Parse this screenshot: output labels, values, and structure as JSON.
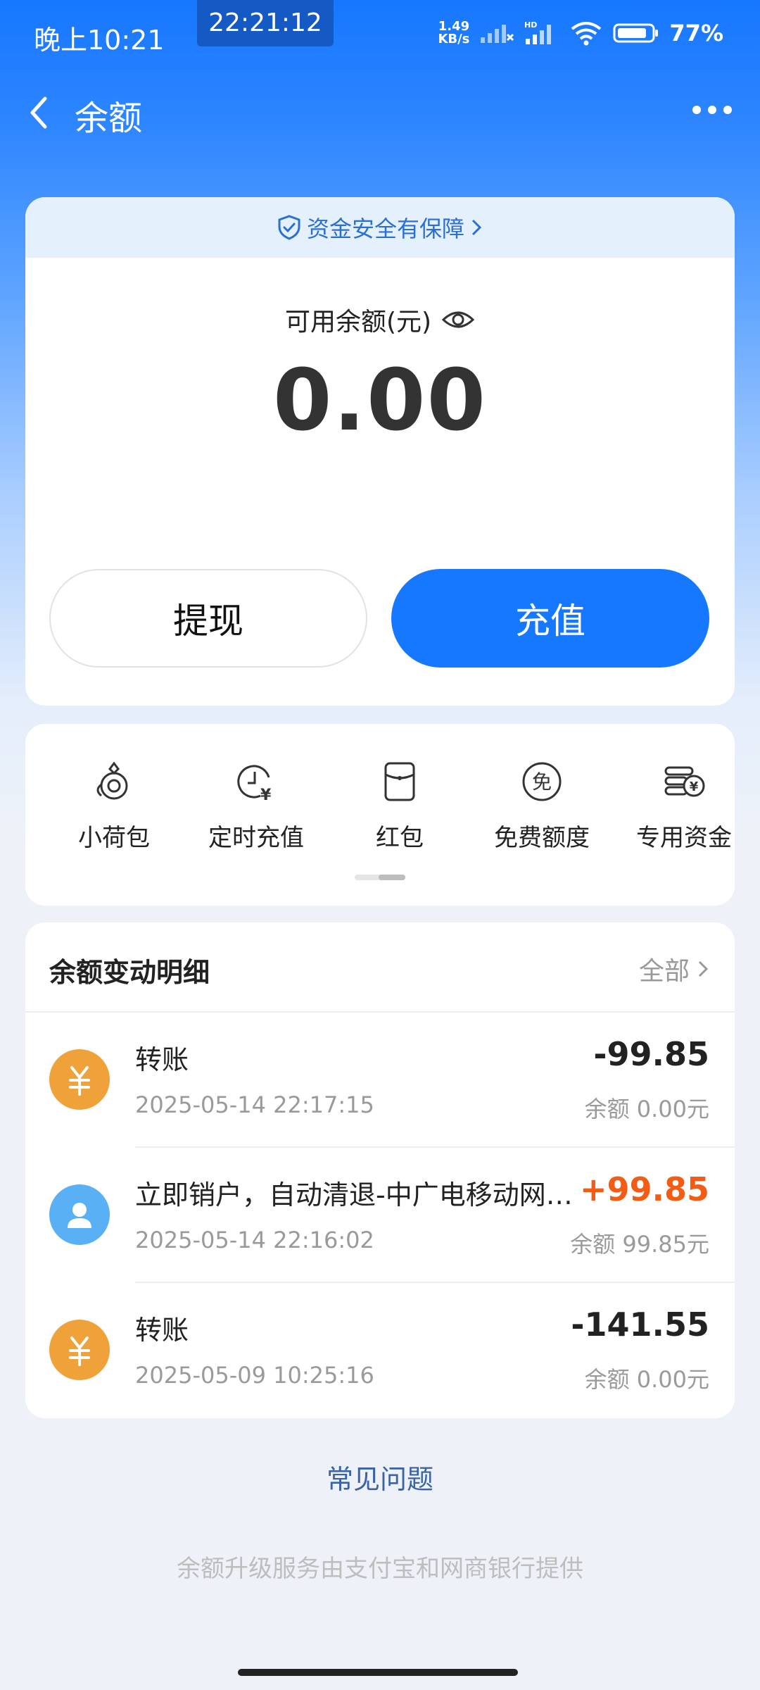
{
  "status_bar": {
    "time": "晚上10:21",
    "clock": "22:21:12",
    "speed_value": "1.49",
    "speed_unit": "KB/s",
    "battery": "77%"
  },
  "nav": {
    "title": "余额"
  },
  "balance_card": {
    "security_text": "资金安全有保障",
    "label": "可用余额(元)",
    "amount": "0.00",
    "withdraw_label": "提现",
    "recharge_label": "充值"
  },
  "shortcuts": [
    {
      "label": "小荷包",
      "icon": "pouch-icon"
    },
    {
      "label": "定时充值",
      "icon": "timer-recharge-icon"
    },
    {
      "label": "红包",
      "icon": "red-packet-icon"
    },
    {
      "label": "免费额度",
      "icon": "free-quota-icon"
    },
    {
      "label": "专用资金",
      "icon": "dedicated-funds-icon"
    }
  ],
  "details": {
    "title": "余额变动明细",
    "filter_label": "全部",
    "transactions": [
      {
        "name": "转账",
        "time": "2025-05-14 22:17:15",
        "amount": "-99.85",
        "balance": "余额 0.00元",
        "icon": "yuan-icon"
      },
      {
        "name": "立即销户，自动清退-中广电移动网络有限公司",
        "time": "2025-05-14 22:16:02",
        "amount": "+99.85",
        "balance": "余额 99.85元",
        "icon": "user-icon"
      },
      {
        "name": "转账",
        "time": "2025-05-09 10:25:16",
        "amount": "-141.55",
        "balance": "余额 0.00元",
        "icon": "yuan-icon"
      }
    ]
  },
  "faq_label": "常见问题",
  "footer_text": "余额升级服务由支付宝和网商银行提供",
  "colors": {
    "primary": "#1677ff",
    "positive_amount": "#f25c14",
    "yuan_avatar": "#f0a23a",
    "user_avatar": "#5ab0f5"
  }
}
